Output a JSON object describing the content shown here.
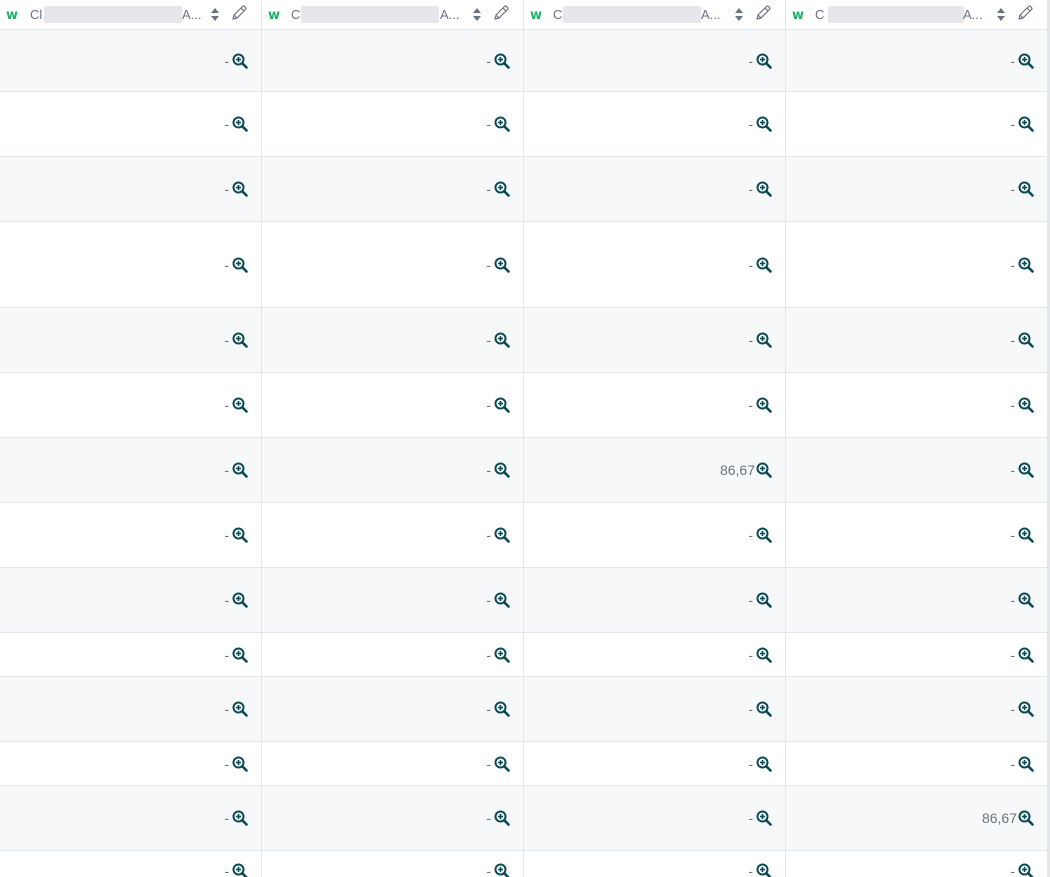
{
  "columns": [
    {
      "badge": "w",
      "name": "Cl",
      "suffix": "A..."
    },
    {
      "badge": "w",
      "name": "C",
      "suffix": "A..."
    },
    {
      "badge": "w",
      "name": "C",
      "suffix": "A..."
    },
    {
      "badge": "w",
      "name": "C",
      "suffix": "A..."
    }
  ],
  "rows": [
    {
      "values": [
        "-",
        "-",
        "-",
        "-"
      ]
    },
    {
      "values": [
        "-",
        "-",
        "-",
        "-"
      ]
    },
    {
      "values": [
        "-",
        "-",
        "-",
        "-"
      ]
    },
    {
      "values": [
        "-",
        "-",
        "-",
        "-"
      ]
    },
    {
      "values": [
        "-",
        "-",
        "-",
        "-"
      ]
    },
    {
      "values": [
        "-",
        "-",
        "-",
        "-"
      ]
    },
    {
      "values": [
        "-",
        "-",
        "86,67",
        "-"
      ]
    },
    {
      "values": [
        "-",
        "-",
        "-",
        "-"
      ]
    },
    {
      "values": [
        "-",
        "-",
        "-",
        "-"
      ]
    },
    {
      "values": [
        "-",
        "-",
        "-",
        "-"
      ]
    },
    {
      "values": [
        "-",
        "-",
        "-",
        "-"
      ]
    },
    {
      "values": [
        "-",
        "-",
        "-",
        "-"
      ]
    },
    {
      "values": [
        "-",
        "-",
        "-",
        "86,67"
      ]
    },
    {
      "values": [
        "-",
        "-",
        "-",
        "-"
      ]
    }
  ],
  "icons": {
    "sort": "sort-icon",
    "edit": "pencil-icon",
    "cell_action": "zoom-in-icon"
  },
  "colors": {
    "badge": "#1bb36a",
    "zoom": "#0b4a52",
    "row_alt": "#f7f8fa",
    "border": "#e3e6ea"
  }
}
